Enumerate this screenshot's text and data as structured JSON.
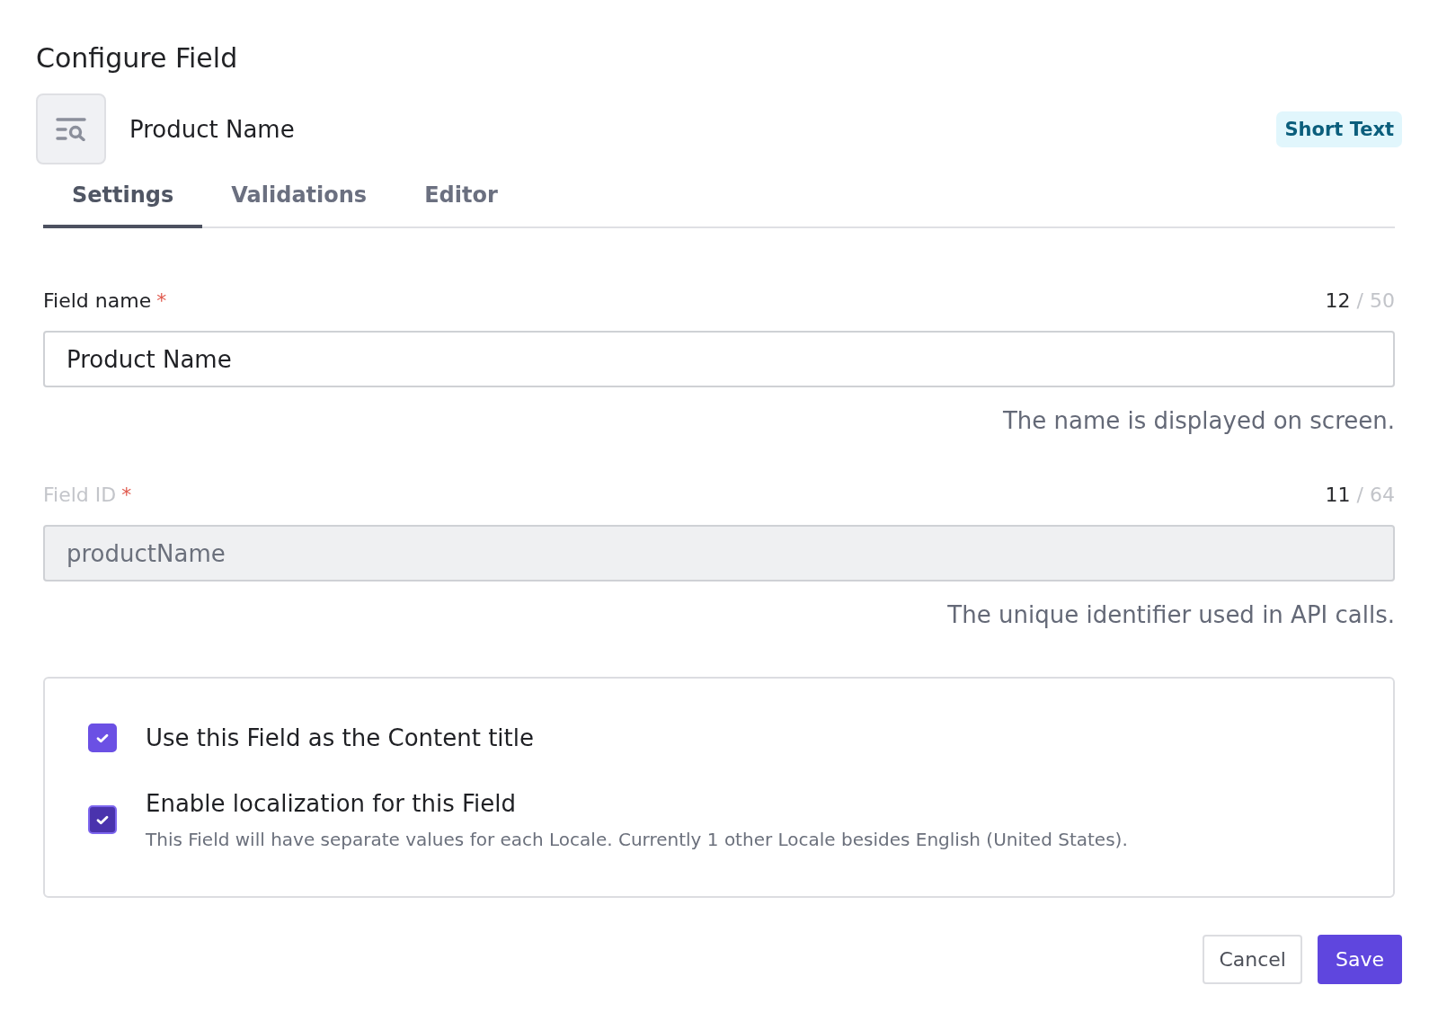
{
  "dialog": {
    "title": "Configure Field"
  },
  "field": {
    "name": "Product Name",
    "type_badge": "Short Text"
  },
  "tabs": [
    {
      "label": "Settings",
      "selected": true
    },
    {
      "label": "Validations",
      "selected": false
    },
    {
      "label": "Editor",
      "selected": false
    }
  ],
  "form_fields": [
    {
      "label": "Field name",
      "required_mark": "*",
      "count": "12",
      "limit": "/ 50",
      "value": "Product Name",
      "help": "The name is displayed on screen.",
      "disabled": false
    },
    {
      "label": "Field ID",
      "required_mark": "*",
      "count": "11",
      "limit": "/ 64",
      "value": "productName",
      "help": "The unique identifier used in API calls.",
      "disabled": true
    }
  ],
  "options": [
    {
      "label": "Use this Field as the Content title",
      "checked": true,
      "focused": false
    },
    {
      "label": "Enable localization for this Field",
      "description": "This Field will have separate values for each Locale. Currently 1 other Locale besides English (United States).",
      "checked": true,
      "focused": true
    }
  ],
  "buttons": [
    {
      "label": "Cancel",
      "kind": "secondary"
    },
    {
      "label": "Save",
      "kind": "primary"
    }
  ]
}
